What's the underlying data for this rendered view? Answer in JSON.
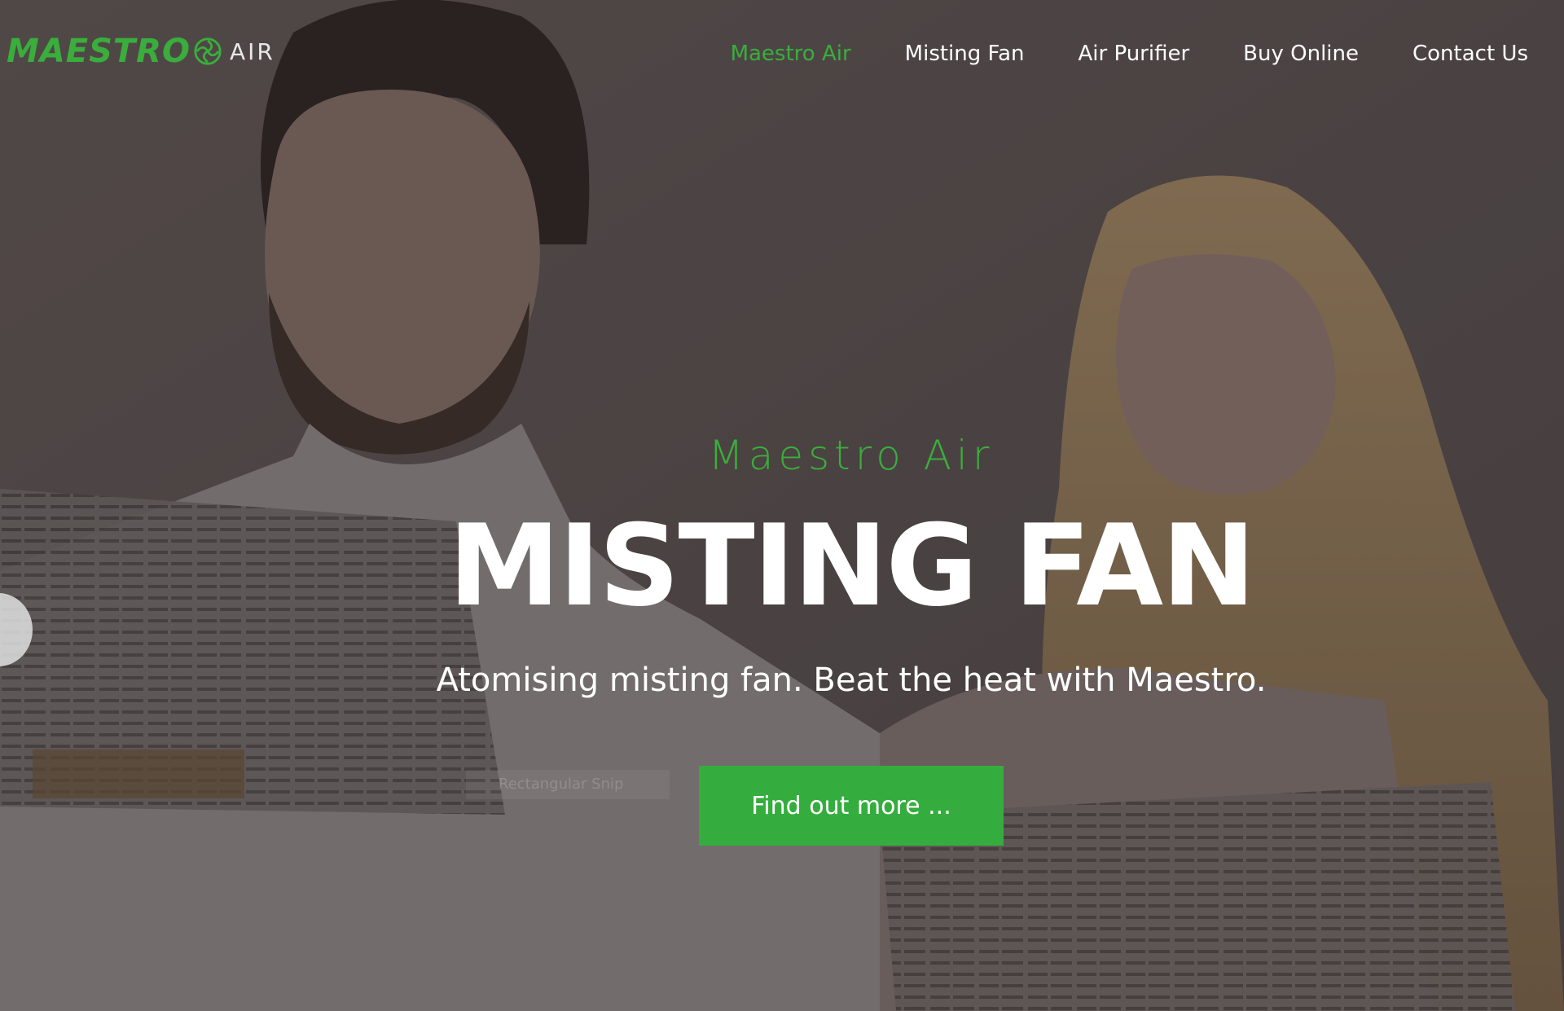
{
  "brand": {
    "logo_main": "MAESTRO",
    "logo_sub": "AIR",
    "accent_color": "#3aae3c"
  },
  "nav": {
    "items": [
      {
        "label": "Maestro Air",
        "active": true
      },
      {
        "label": "Misting Fan",
        "active": false
      },
      {
        "label": "Air Purifier",
        "active": false
      },
      {
        "label": "Buy Online",
        "active": false
      },
      {
        "label": "Contact Us",
        "active": false
      }
    ]
  },
  "hero": {
    "eyebrow": "Maestro Air",
    "headline": "MISTING FAN",
    "subheadline": "Atomising misting fan. Beat the heat with Maestro.",
    "cta_label": "Find out more ...",
    "ghost_label": "Rectangular Snip"
  },
  "colors": {
    "cta_background": "#35ad3e",
    "text_primary": "#ffffff"
  }
}
